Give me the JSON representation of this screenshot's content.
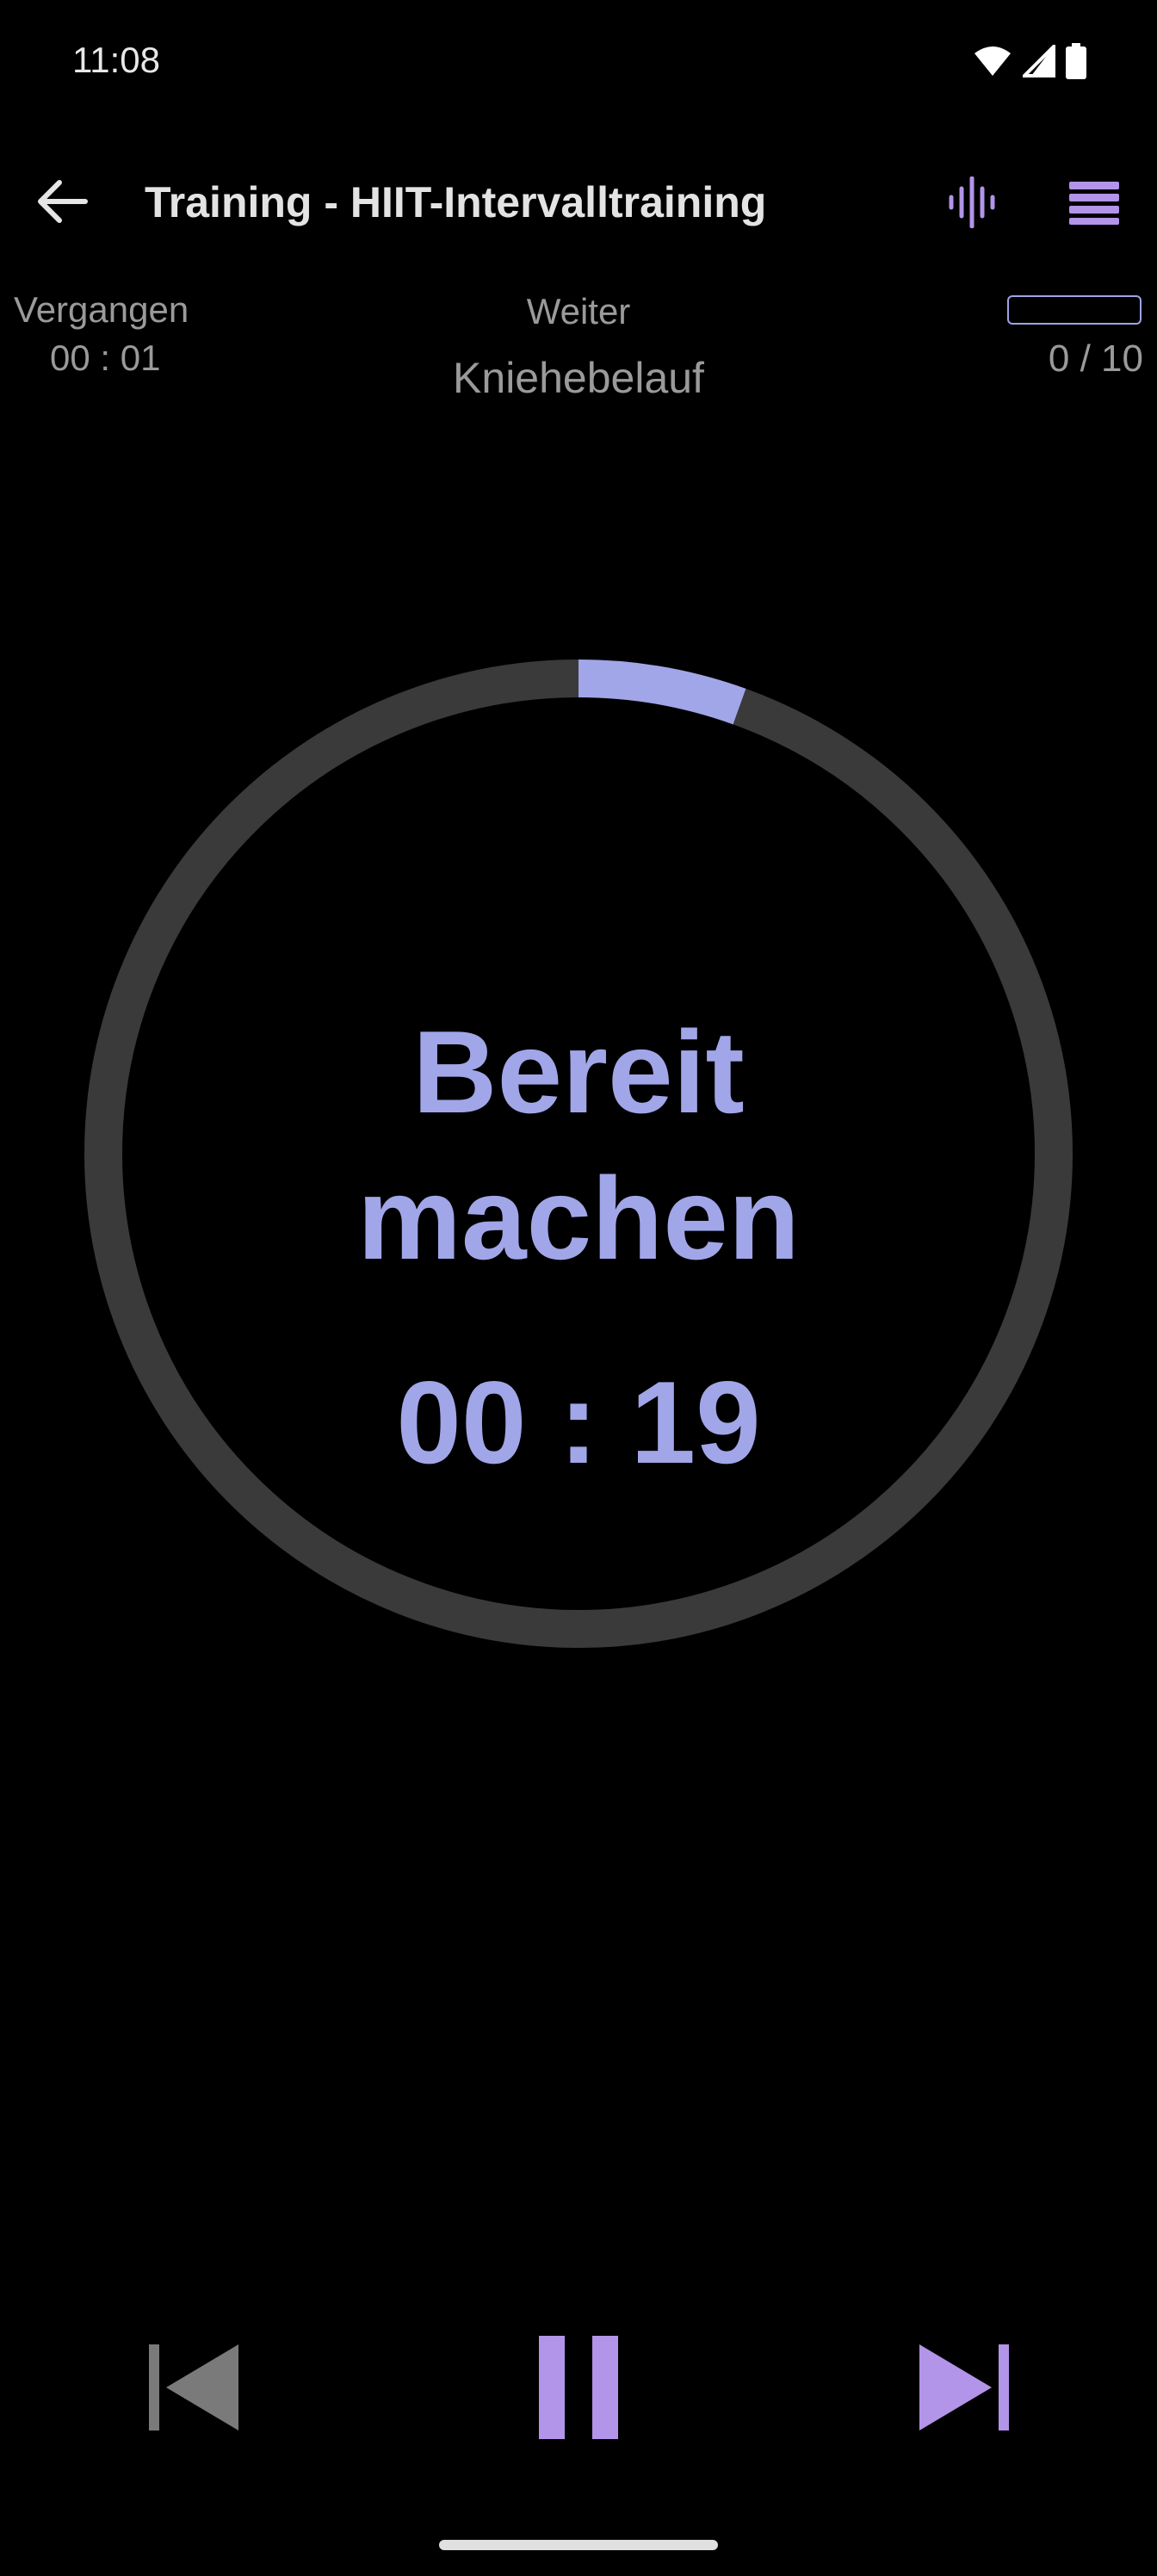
{
  "status_bar": {
    "time": "11:08"
  },
  "app_bar": {
    "title": "Training - HIIT-Intervalltraining",
    "back_icon": "arrow-back-icon",
    "voice_icon": "voice-waveform-icon",
    "menu_icon": "list-menu-icon"
  },
  "info": {
    "elapsed_label": "Vergangen",
    "elapsed_value": "00 : 01",
    "next_label": "Weiter",
    "next_value": "Kniehebelauf",
    "progress_fraction": 0.0,
    "progress_count": "0 / 10"
  },
  "timer": {
    "phase": "Bereit machen",
    "remaining": "00 : 19",
    "ring_progress_fraction": 0.055
  },
  "controls": {
    "prev_icon": "skip-previous-icon",
    "pause_icon": "pause-icon",
    "next_icon": "skip-next-icon"
  },
  "colors": {
    "accent": "#a1a6e8",
    "accent_purple": "#b294e8",
    "ring_track": "#3a3a3a",
    "background": "#000000"
  }
}
